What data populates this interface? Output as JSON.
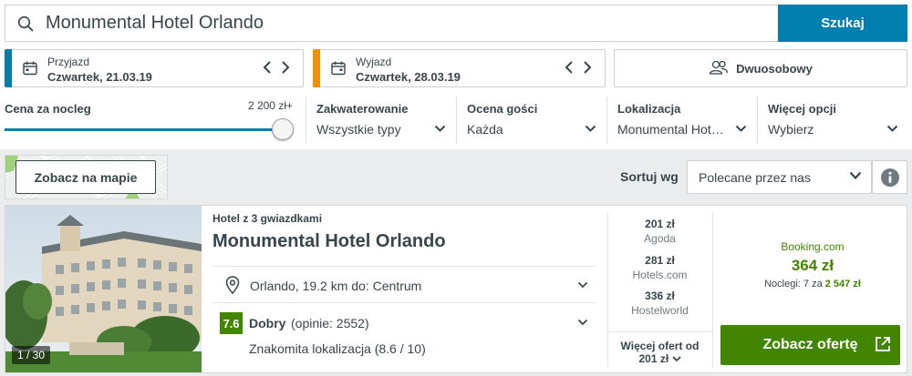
{
  "search": {
    "query": "Monumental Hotel Orlando",
    "button_label": "Szukaj"
  },
  "checkin": {
    "label": "Przyjazd",
    "date": "Czwartek, 21.03.19",
    "accent": "#007faf"
  },
  "checkout": {
    "label": "Wyjazd",
    "date": "Czwartek, 28.03.19",
    "accent": "#f48f00"
  },
  "room": {
    "label": "Dwuosobowy",
    "icon": "people-icon"
  },
  "filters": {
    "price": {
      "title": "Cena za nocleg",
      "max_label": "2 200 zł+",
      "level": 1.0
    },
    "accommodation": {
      "title": "Zakwaterowanie",
      "value": "Wszystkie typy"
    },
    "rating": {
      "title": "Ocena gości",
      "value": "Każda"
    },
    "location": {
      "title": "Lokalizacja",
      "value": "Monumental Hot…"
    },
    "more": {
      "title": "Więcej opcji",
      "value": "Wybierz"
    }
  },
  "map": {
    "button_label": "Zobacz na mapie"
  },
  "sort": {
    "label": "Sortuj wg",
    "value": "Polecane przez nas"
  },
  "result": {
    "photo_counter": "1 / 30",
    "category": "Hotel z 3 gwiazdkami",
    "name": "Monumental Hotel Orlando",
    "location": "Orlando, 19.2 km do: Centrum",
    "rating_score": "7.6",
    "rating_word": "Dobry",
    "rating_count": "(opinie: 2552)",
    "location_score": "Znakomita lokalizacja (8.6 / 10)",
    "deals": [
      {
        "price": "201 zł",
        "site": "Agoda"
      },
      {
        "price": "281 zł",
        "site": "Hotels.com"
      },
      {
        "price": "336 zł",
        "site": "Hostelworld"
      }
    ],
    "more_offers_line1": "Więcej ofert od",
    "more_offers_line2": "201 zł",
    "best": {
      "site": "Booking.com",
      "price": "364 zł",
      "nights_prefix": "Noclegi: 7 za",
      "nights_total": "2 547 zł"
    },
    "offer_button": "Zobacz ofertę",
    "brand_green": "#428500"
  }
}
